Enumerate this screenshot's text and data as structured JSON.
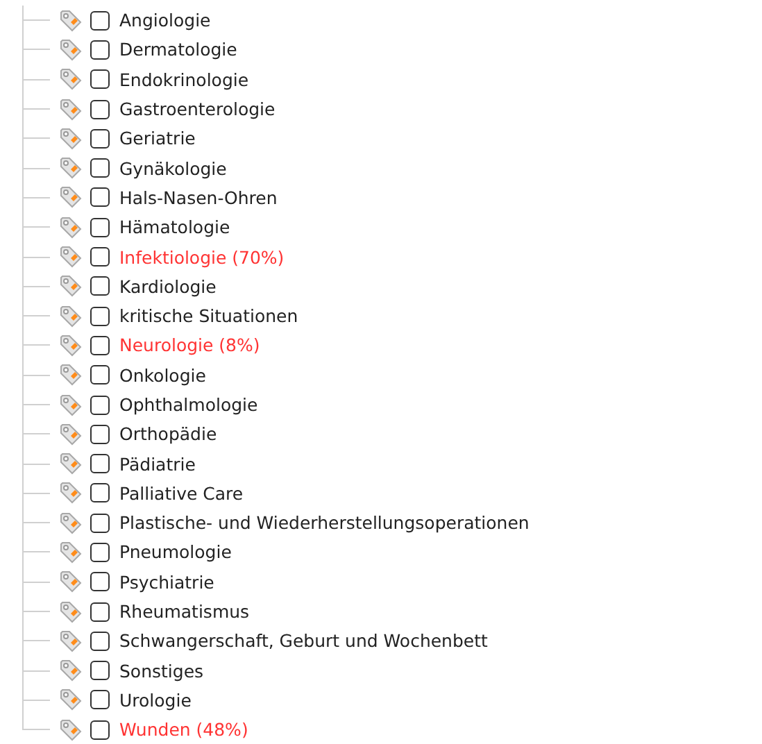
{
  "items": [
    {
      "label": "Angiologie",
      "checked": false,
      "highlighted": false
    },
    {
      "label": "Dermatologie",
      "checked": false,
      "highlighted": false
    },
    {
      "label": "Endokrinologie",
      "checked": false,
      "highlighted": false
    },
    {
      "label": "Gastroenterologie",
      "checked": false,
      "highlighted": false
    },
    {
      "label": "Geriatrie",
      "checked": false,
      "highlighted": false
    },
    {
      "label": "Gynäkologie",
      "checked": false,
      "highlighted": false
    },
    {
      "label": "Hals-Nasen-Ohren",
      "checked": false,
      "highlighted": false
    },
    {
      "label": "Hämatologie",
      "checked": false,
      "highlighted": false
    },
    {
      "label": "Infektiologie (70%)",
      "checked": false,
      "highlighted": true
    },
    {
      "label": "Kardiologie",
      "checked": false,
      "highlighted": false
    },
    {
      "label": "kritische Situationen",
      "checked": false,
      "highlighted": false
    },
    {
      "label": "Neurologie (8%)",
      "checked": false,
      "highlighted": true
    },
    {
      "label": "Onkologie",
      "checked": false,
      "highlighted": false
    },
    {
      "label": "Ophthalmologie",
      "checked": false,
      "highlighted": false
    },
    {
      "label": "Orthopädie",
      "checked": false,
      "highlighted": false
    },
    {
      "label": "Pädiatrie",
      "checked": false,
      "highlighted": false
    },
    {
      "label": "Palliative Care",
      "checked": false,
      "highlighted": false
    },
    {
      "label": "Plastische- und Wiederherstellungsoperationen",
      "checked": false,
      "highlighted": false
    },
    {
      "label": "Pneumologie",
      "checked": false,
      "highlighted": false
    },
    {
      "label": "Psychiatrie",
      "checked": false,
      "highlighted": false
    },
    {
      "label": "Rheumatismus",
      "checked": false,
      "highlighted": false
    },
    {
      "label": "Schwangerschaft, Geburt und Wochenbett",
      "checked": false,
      "highlighted": false
    },
    {
      "label": "Sonstiges",
      "checked": false,
      "highlighted": false
    },
    {
      "label": "Urologie",
      "checked": false,
      "highlighted": false
    },
    {
      "label": "Wunden (48%)",
      "checked": false,
      "highlighted": true
    }
  ]
}
